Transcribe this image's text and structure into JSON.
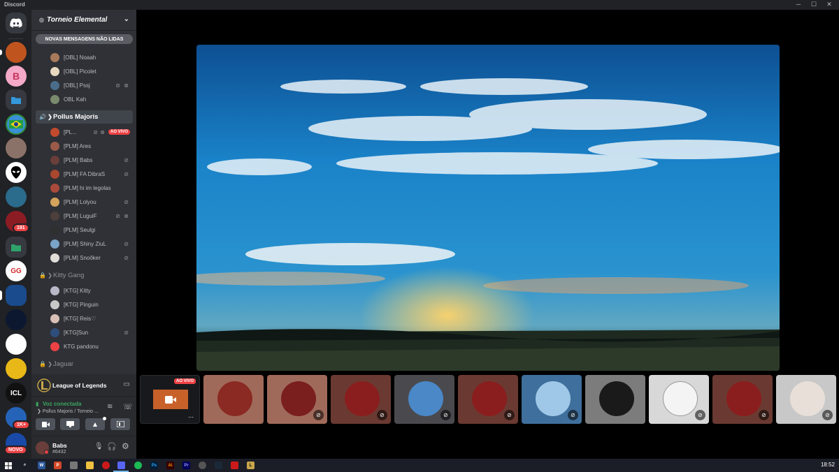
{
  "window": {
    "title": "Discord"
  },
  "server": {
    "name": "Torneio Elemental"
  },
  "unread_banner": "NOVAS MENSAGENS NÃO LIDAS",
  "guild_badges": {
    "mentions": "191",
    "dm_count": "1K+",
    "new": "NOVO"
  },
  "members_top": [
    {
      "name": "[OBL] Noaah",
      "color": "#a87a5c"
    },
    {
      "name": "[OBL] Picolet",
      "color": "#e8d8c0"
    },
    {
      "name": "[OBL] Pssj",
      "color": "#4a6d8c",
      "muted": true,
      "deafened": true
    },
    {
      "name": "OBL Kah",
      "color": "#7a8a6d"
    }
  ],
  "channels": [
    {
      "name": "Pollus Majoris",
      "active": true,
      "members": [
        {
          "name": "[PL...",
          "color": "#c24a2e",
          "live": "AO VIVO"
        },
        {
          "name": "[PLM] Ares",
          "color": "#9b5a4a"
        },
        {
          "name": "[PLM] Babs",
          "color": "#6a3e3a",
          "muted": true
        },
        {
          "name": "[PLM] FA DibraS",
          "color": "#a9472f",
          "muted": true
        },
        {
          "name": "[PLM] hi im legolas",
          "color": "#aa4a3c"
        },
        {
          "name": "[PLM] Lolyou",
          "color": "#d4a45c",
          "muted": true
        },
        {
          "name": "[PLM] LuguiF",
          "color": "#4d3f3b",
          "muted": true,
          "deafened": true
        },
        {
          "name": "[PLM] Seulgi",
          "color": "#2f2f2f"
        },
        {
          "name": "[PLM] Shiny ZiuL",
          "color": "#7aa3c8",
          "muted": true
        },
        {
          "name": "[PLM] Snoôker",
          "color": "#e0dcd8",
          "muted": true
        }
      ]
    },
    {
      "name": "Kitty Gang",
      "locked": true,
      "members": [
        {
          "name": "[KTG] Kitty",
          "color": "#b8b8c8"
        },
        {
          "name": "[KTG] Pinguin",
          "color": "#c8c8c8"
        },
        {
          "name": "[KTG] Reis♡",
          "color": "#d8c0b8"
        },
        {
          "name": "[KTG]Sun",
          "color": "#2e4d7a",
          "muted": true
        },
        {
          "name": "KTG pandonu",
          "color": "#ed4245"
        }
      ]
    },
    {
      "name": "Jaguar",
      "locked": true
    }
  ],
  "activity": {
    "game": "League of Legends"
  },
  "voice": {
    "status": "Voz conectada",
    "location": "Pollus Majoris / Torneio ..."
  },
  "user": {
    "name": "Babs",
    "tag": "#6432"
  },
  "stream_tile": {
    "live": "AO VIVO"
  },
  "taskbar": {
    "time": "18:52"
  },
  "colors": {
    "accent": "#5865f2",
    "live": "#ed4245",
    "connected": "#3ba55d"
  }
}
